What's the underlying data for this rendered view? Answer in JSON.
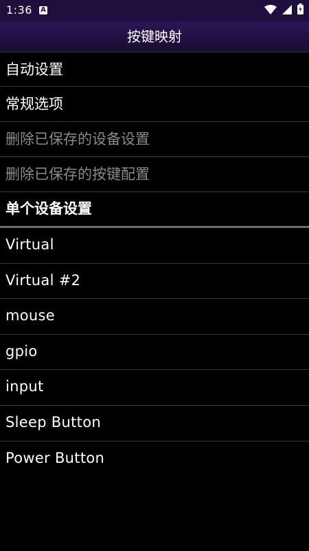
{
  "status_bar": {
    "time": "1:36",
    "notification_icon": "A",
    "icons": [
      "wifi-icon",
      "signal-icon",
      "battery-icon"
    ]
  },
  "app_bar": {
    "title": "按键映射"
  },
  "menu": {
    "items": [
      {
        "label": "自动设置",
        "enabled": true
      },
      {
        "label": "常规选项",
        "enabled": true
      },
      {
        "label": "删除已保存的设备设置",
        "enabled": false
      },
      {
        "label": "删除已保存的按键配置",
        "enabled": false
      }
    ]
  },
  "devices": {
    "header": "单个设备设置",
    "items": [
      {
        "label": "Virtual"
      },
      {
        "label": "Virtual #2"
      },
      {
        "label": "mouse"
      },
      {
        "label": "gpio"
      },
      {
        "label": "input"
      },
      {
        "label": "Sleep Button"
      },
      {
        "label": "Power Button"
      }
    ]
  },
  "colors": {
    "status_bar_bg": "#1f0f3e",
    "app_bar_bg": "#2a1656",
    "background": "#000000",
    "text": "#ffffff",
    "disabled_text": "#8a8a8a",
    "divider": "#3a3a3a"
  }
}
